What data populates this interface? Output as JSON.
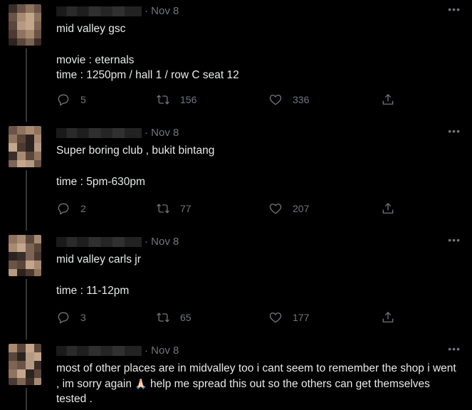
{
  "tweets": [
    {
      "date": "· Nov 8",
      "more": "•••",
      "lines": [
        "mid valley gsc",
        "",
        "movie : eternals",
        "time : 1250pm / hall 1 / row C seat 12"
      ],
      "replies": "5",
      "retweets": "156",
      "likes": "336"
    },
    {
      "date": "· Nov 8",
      "more": "•••",
      "lines": [
        "Super boring club , bukit bintang",
        "",
        "time : 5pm-630pm"
      ],
      "replies": "2",
      "retweets": "77",
      "likes": "207"
    },
    {
      "date": "· Nov 8",
      "more": "•••",
      "lines": [
        "mid valley carls jr",
        "",
        "time : 11-12pm"
      ],
      "replies": "3",
      "retweets": "65",
      "likes": "177"
    },
    {
      "date": "· Nov 8",
      "more": "•••",
      "text_a": "most of other places are in midvalley too i cant seem to remember the shop i went , im sorry again ",
      "emoji": "🙏🏻",
      "text_b": " help me spread this out so the others can get themselves tested ."
    }
  ],
  "icons": {
    "reply": "reply-icon",
    "retweet": "retweet-icon",
    "like": "like-icon",
    "share": "share-icon"
  },
  "colors": {
    "background": "#000000",
    "text": "#e7e9ea",
    "muted": "#71767b",
    "thread_line": "#333639"
  }
}
